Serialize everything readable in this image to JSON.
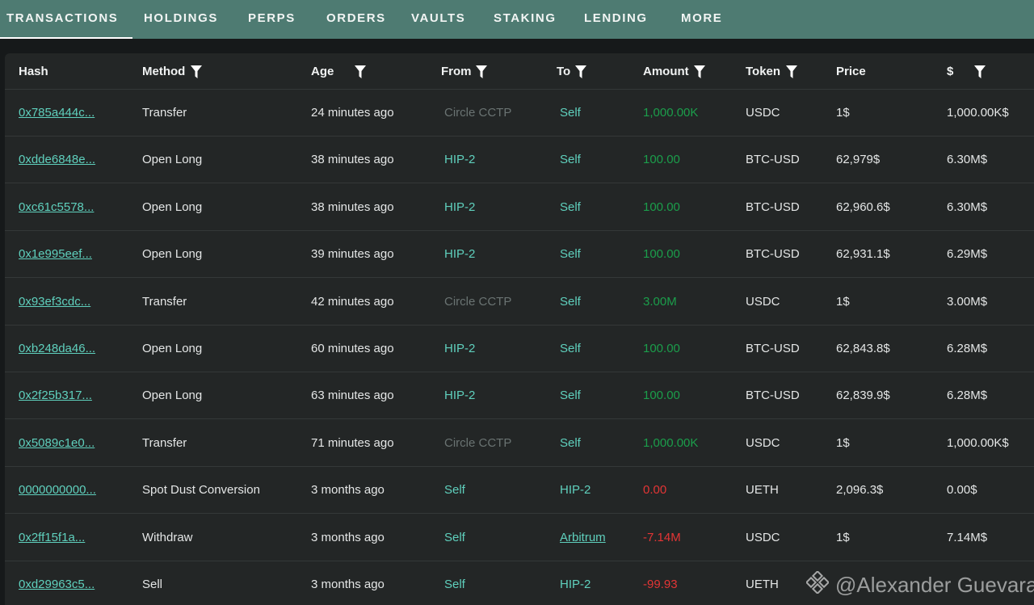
{
  "tabs": [
    "TRANSACTIONS",
    "HOLDINGS",
    "PERPS",
    "ORDERS",
    "VAULTS",
    "STAKING",
    "LENDING",
    "MORE"
  ],
  "active_tab": "TRANSACTIONS",
  "columns": [
    "Hash",
    "Method",
    "Age",
    "From",
    "To",
    "Amount",
    "Token",
    "Price",
    "$"
  ],
  "filterable_columns": [
    "Method",
    "Age",
    "From",
    "To",
    "Amount",
    "Token",
    "$"
  ],
  "rows": [
    {
      "hash": "0x785a444c...",
      "method": "Transfer",
      "age": "24 minutes ago",
      "from": "Circle CCTP",
      "to": "Self",
      "amount": "1,000.00K",
      "amount_sign": "positive",
      "token": "USDC",
      "price": "1$",
      "usd": "1,000.00K$"
    },
    {
      "hash": "0xdde6848e...",
      "method": "Open Long",
      "age": "38 minutes ago",
      "from": "HIP-2",
      "to": "Self",
      "amount": "100.00",
      "amount_sign": "positive",
      "token": "BTC-USD",
      "price": "62,979$",
      "usd": "6.30M$"
    },
    {
      "hash": "0xc61c5578...",
      "method": "Open Long",
      "age": "38 minutes ago",
      "from": "HIP-2",
      "to": "Self",
      "amount": "100.00",
      "amount_sign": "positive",
      "token": "BTC-USD",
      "price": "62,960.6$",
      "usd": "6.30M$"
    },
    {
      "hash": "0x1e995eef...",
      "method": "Open Long",
      "age": "39 minutes ago",
      "from": "HIP-2",
      "to": "Self",
      "amount": "100.00",
      "amount_sign": "positive",
      "token": "BTC-USD",
      "price": "62,931.1$",
      "usd": "6.29M$"
    },
    {
      "hash": "0x93ef3cdc...",
      "method": "Transfer",
      "age": "42 minutes ago",
      "from": "Circle CCTP",
      "to": "Self",
      "amount": "3.00M",
      "amount_sign": "positive",
      "token": "USDC",
      "price": "1$",
      "usd": "3.00M$"
    },
    {
      "hash": "0xb248da46...",
      "method": "Open Long",
      "age": "60 minutes ago",
      "from": "HIP-2",
      "to": "Self",
      "amount": "100.00",
      "amount_sign": "positive",
      "token": "BTC-USD",
      "price": "62,843.8$",
      "usd": "6.28M$"
    },
    {
      "hash": "0x2f25b317...",
      "method": "Open Long",
      "age": "63 minutes ago",
      "from": "HIP-2",
      "to": "Self",
      "amount": "100.00",
      "amount_sign": "positive",
      "token": "BTC-USD",
      "price": "62,839.9$",
      "usd": "6.28M$"
    },
    {
      "hash": "0x5089c1e0...",
      "method": "Transfer",
      "age": "71 minutes ago",
      "from": "Circle CCTP",
      "to": "Self",
      "amount": "1,000.00K",
      "amount_sign": "positive",
      "token": "USDC",
      "price": "1$",
      "usd": "1,000.00K$"
    },
    {
      "hash": "0000000000...",
      "method": "Spot Dust Conversion",
      "age": "3 months ago",
      "from": "Self",
      "to": "HIP-2",
      "amount": "0.00",
      "amount_sign": "negative",
      "token": "UETH",
      "price": "2,096.3$",
      "usd": "0.00$"
    },
    {
      "hash": "0x2ff15f1a...",
      "method": "Withdraw",
      "age": "3 months ago",
      "from": "Self",
      "to": "Arbitrum",
      "to_is_link": true,
      "amount": "-7.14M",
      "amount_sign": "negative",
      "token": "USDC",
      "price": "1$",
      "usd": "7.14M$"
    },
    {
      "hash": "0xd29963c5...",
      "method": "Sell",
      "age": "3 months ago",
      "from": "Self",
      "to": "HIP-2",
      "amount": "-99.93",
      "amount_sign": "negative",
      "token": "UETH",
      "price": "",
      "usd": ""
    }
  ],
  "watermark": "@Alexander Guevara",
  "watermark_icon": "binance-logo-icon",
  "colors": {
    "tab_bar": "#4e7b72",
    "background": "#16191a",
    "panel": "#232626",
    "teal_link": "#5fd0bd",
    "positive": "#1b9e4b",
    "negative": "#e33535",
    "muted_source": "#6a7372"
  }
}
